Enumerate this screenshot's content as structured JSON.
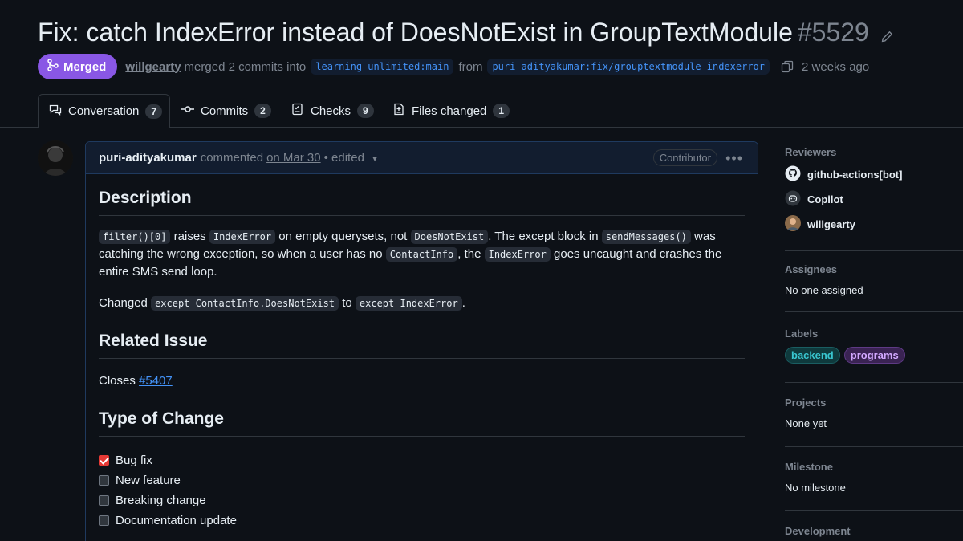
{
  "pr": {
    "title": "Fix: catch IndexError instead of DoesNotExist in GroupTextModule",
    "number": "#5529",
    "state": "Merged",
    "author": "willgearty",
    "merged_text": "merged 2 commits into",
    "base_branch": "learning-unlimited:main",
    "from_text": "from",
    "head_branch": "puri-adityakumar:fix/grouptextmodule-indexerror",
    "time_ago": "2 weeks ago"
  },
  "tabs": [
    {
      "label": "Conversation",
      "count": "7"
    },
    {
      "label": "Commits",
      "count": "2"
    },
    {
      "label": "Checks",
      "count": "9"
    },
    {
      "label": "Files changed",
      "count": "1"
    }
  ],
  "comment": {
    "author": "puri-adityakumar",
    "action": "commented",
    "date": "on Mar 30",
    "edited": "• edited",
    "role": "Contributor",
    "h_description": "Description",
    "p1": {
      "c1": "filter()[0]",
      "t1": "raises",
      "c2": "IndexError",
      "t2": "on empty querysets, not",
      "c3": "DoesNotExist",
      "t3": ". The except block in",
      "c4": "sendMessages()",
      "t4": "was catching",
      "t5": "the wrong exception, so when a user has no",
      "c5": "ContactInfo",
      "t6": ", the",
      "c6": "IndexError",
      "t7": "goes uncaught and crashes the entire SMS send",
      "t8": "loop."
    },
    "p2": {
      "t1": "Changed",
      "c1": "except ContactInfo.DoesNotExist",
      "t2": "to",
      "c2": "except IndexError",
      "t3": "."
    },
    "h_related": "Related Issue",
    "closes": "Closes",
    "issue": "#5407",
    "h_type": "Type of Change",
    "checklist": [
      {
        "label": "Bug fix",
        "checked": true
      },
      {
        "label": "New feature",
        "checked": false
      },
      {
        "label": "Breaking change",
        "checked": false
      },
      {
        "label": "Documentation update",
        "checked": false
      }
    ]
  },
  "sidebar": {
    "reviewers_heading": "Reviewers",
    "reviewers": [
      {
        "name": "github-actions[bot]",
        "icon": "github-icon"
      },
      {
        "name": "Copilot",
        "icon": "copilot-icon"
      },
      {
        "name": "willgearty",
        "icon": "avatar"
      }
    ],
    "assignees_heading": "Assignees",
    "assignees_value": "No one assigned",
    "labels_heading": "Labels",
    "labels": [
      {
        "name": "backend",
        "color": "#39c5cf"
      },
      {
        "name": "programs",
        "color": "#d2a8ff"
      }
    ],
    "projects_heading": "Projects",
    "projects_value": "None yet",
    "milestone_heading": "Milestone",
    "milestone_value": "No milestone",
    "development_heading": "Development"
  },
  "colors": {
    "merged": "#8957e5",
    "link": "#4493f8",
    "background": "#0d1117",
    "checkbox_checked": "#e53935"
  }
}
